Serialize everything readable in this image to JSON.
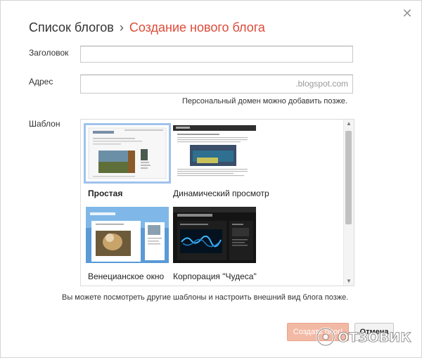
{
  "dialog": {
    "breadcrumb_parent": "Список блогов",
    "breadcrumb_separator": "›",
    "breadcrumb_current": "Создание нового блога",
    "close_icon": "close-icon"
  },
  "form": {
    "title_label": "Заголовок",
    "title_value": "",
    "address_label": "Адрес",
    "address_value": "",
    "address_suffix": ".blogspot.com",
    "address_hint": "Персональный домен можно добавить позже.",
    "template_label": "Шаблон"
  },
  "templates": [
    {
      "name": "Простая",
      "selected": true
    },
    {
      "name": "Динамический просмотр",
      "selected": false
    },
    {
      "name": "Венецианское окно",
      "selected": false
    },
    {
      "name": "Корпорация \"Чудеса\"",
      "selected": false
    }
  ],
  "footer": {
    "hint": "Вы можете посмотреть другие шаблоны и настроить внешний вид блога позже.",
    "create_label": "Создать блог!",
    "cancel_label": "Отмена"
  },
  "watermark": {
    "text": "ОТЗОВИК"
  },
  "colors": {
    "accent": "#dd4b39",
    "selected_outline": "#a0c2ec"
  }
}
